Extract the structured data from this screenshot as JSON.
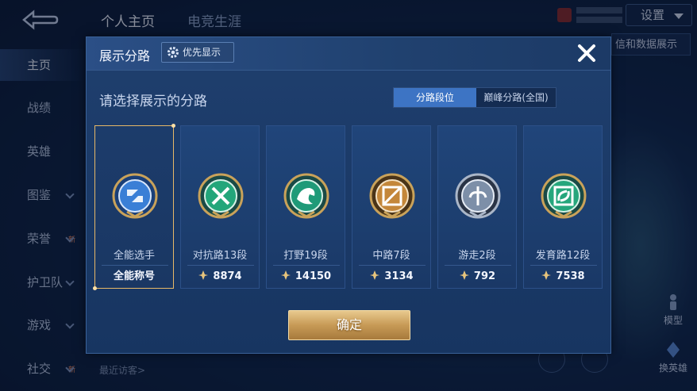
{
  "background": {
    "top_tabs": [
      "个人主页",
      "电竞生涯"
    ],
    "settings_label": "设置",
    "side_button_label": "信和数据展示",
    "nav_items": [
      {
        "label": "主页",
        "active": true,
        "chevron": false,
        "new": false
      },
      {
        "label": "战绩",
        "active": false,
        "chevron": false,
        "new": false
      },
      {
        "label": "英雄",
        "active": false,
        "chevron": false,
        "new": false
      },
      {
        "label": "图鉴",
        "active": false,
        "chevron": true,
        "new": false
      },
      {
        "label": "荣誉",
        "active": false,
        "chevron": true,
        "new": true
      },
      {
        "label": "护卫队",
        "active": false,
        "chevron": true,
        "new": false
      },
      {
        "label": "游戏",
        "active": false,
        "chevron": true,
        "new": false
      },
      {
        "label": "社交",
        "active": false,
        "chevron": true,
        "new": true
      }
    ],
    "new_tag": "新",
    "recent_visitors": "最近访客>",
    "model_label": "模型",
    "swap_hero_label": "换英雄"
  },
  "modal": {
    "title": "展示分路",
    "priority_button": "优先显示",
    "section_title": "请选择展示的分路",
    "segments": [
      "分路段位",
      "巅峰分路(全国)"
    ],
    "active_segment": 0,
    "confirm_label": "确定",
    "cards": [
      {
        "label": "全能选手",
        "footer": "全能称号",
        "score": "",
        "selected": true,
        "emblem": "all-round-emblem-icon",
        "color": "#3a7fd6"
      },
      {
        "label": "对抗路13段",
        "footer": "",
        "score": "8874",
        "selected": false,
        "emblem": "clash-lane-emblem-icon",
        "color": "#23a67a"
      },
      {
        "label": "打野19段",
        "footer": "",
        "score": "14150",
        "selected": false,
        "emblem": "jungle-emblem-icon",
        "color": "#1f9a78"
      },
      {
        "label": "中路7段",
        "footer": "",
        "score": "3134",
        "selected": false,
        "emblem": "mid-lane-emblem-icon",
        "color": "#c4873a"
      },
      {
        "label": "游走2段",
        "footer": "",
        "score": "792",
        "selected": false,
        "emblem": "roam-emblem-icon",
        "color": "#7d8fa8"
      },
      {
        "label": "发育路12段",
        "footer": "",
        "score": "7538",
        "selected": false,
        "emblem": "farm-lane-emblem-icon",
        "color": "#26a67c"
      }
    ]
  },
  "colors": {
    "accent_blue": "#3d74c4",
    "gold": "#e7b867",
    "panel": "#1f3f6e"
  }
}
